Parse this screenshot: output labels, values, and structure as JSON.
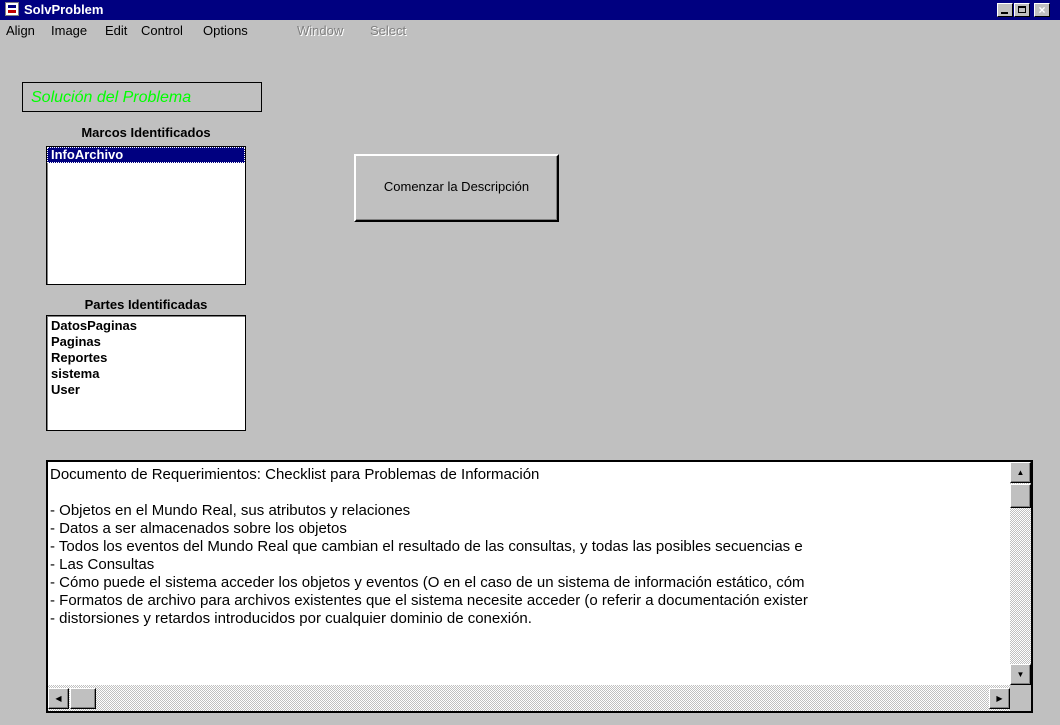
{
  "window": {
    "title": "SolvProblem",
    "minimize": "_",
    "maximize": "",
    "close": "×"
  },
  "menu": {
    "items": [
      {
        "label": "Align",
        "enabled": true
      },
      {
        "label": "Image",
        "enabled": true
      },
      {
        "label": "Edit",
        "enabled": true
      },
      {
        "label": "Control",
        "enabled": true
      },
      {
        "label": "Options",
        "enabled": true
      },
      {
        "label": "Window",
        "enabled": false
      },
      {
        "label": "Select",
        "enabled": false
      }
    ]
  },
  "solution_label": "Solución del Problema",
  "frames": {
    "label": "Marcos Identificados",
    "items": [
      "InfoArchivo"
    ],
    "selected_index": 0
  },
  "parts": {
    "label": "Partes Identificadas",
    "items": [
      "DatosPaginas",
      "Paginas",
      "Reportes",
      "sistema",
      "User"
    ]
  },
  "start_button": "Comenzar la Descripción",
  "document": {
    "lines": [
      "Documento de Requerimientos: Checklist para Problemas de Información",
      "",
      "- Objetos en el Mundo Real, sus atributos y relaciones",
      "- Datos a ser almacenados sobre los objetos",
      "- Todos los eventos del Mundo Real que cambian el resultado de las consultas, y todas las posibles secuencias e",
      "- Las Consultas",
      "- Cómo puede el sistema acceder los objetos y eventos (O en el caso de un sistema de información estático, cóm",
      "- Formatos de archivo para archivos existentes que el sistema necesite acceder (o referir a documentación exister",
      "- distorsiones y retardos introducidos por cualquier dominio de conexión."
    ]
  },
  "colors": {
    "titlebar": "#000080",
    "face": "#c0c0c0",
    "solution_text": "#00ff00",
    "selection": "#000080"
  },
  "scrollbars": {
    "up_icon": "▲",
    "down_icon": "▼",
    "left_icon": "◀",
    "right_icon": "▶"
  }
}
